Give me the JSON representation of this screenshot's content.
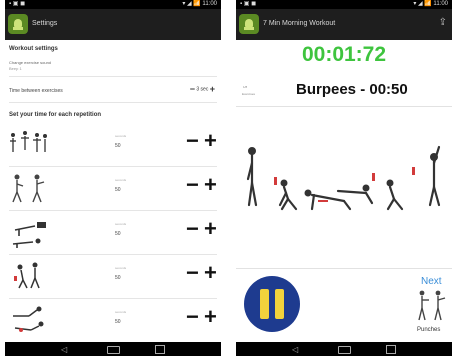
{
  "left": {
    "status": {
      "left": "▪ ▣ ◼",
      "right": "▾ ◢ 📶 11:00"
    },
    "title": "Settings",
    "workout_settings": {
      "heading": "Workout settings",
      "change_label": "Change exercise sound",
      "change_value": "Beep 1",
      "between_label": "Time between exercises",
      "between_value": "3 sec"
    },
    "reps_heading": "Set your time for each repetition",
    "unit_label": "seconds",
    "rows": [
      {
        "name": "exercise-1",
        "value": "50"
      },
      {
        "name": "exercise-2",
        "value": "50"
      },
      {
        "name": "exercise-3",
        "value": "50"
      },
      {
        "name": "exercise-4",
        "value": "50"
      },
      {
        "name": "exercise-5",
        "value": "50"
      }
    ],
    "minus": "−",
    "plus": "+"
  },
  "right": {
    "status": {
      "left": "▪ ▣ ◼",
      "right": "▾ ◢ 📶 11:00"
    },
    "title": "7 Min Morning Workout",
    "timer": "00:01:72",
    "set_label": "1/8",
    "set_sub": "Exercises",
    "exercise": "Burpees - 00:50",
    "next": "Next",
    "next_exercise": "Punches"
  },
  "colors": {
    "timer": "#3ec43e",
    "pause_bg": "#1e3b8f",
    "pause_bars": "#f2d23c",
    "next": "#3a8ed8",
    "actionbar": "#1e1e1e"
  },
  "icons": [
    "app-icon",
    "share-icon",
    "back-icon",
    "home-icon",
    "recents-icon",
    "pause-icon"
  ]
}
